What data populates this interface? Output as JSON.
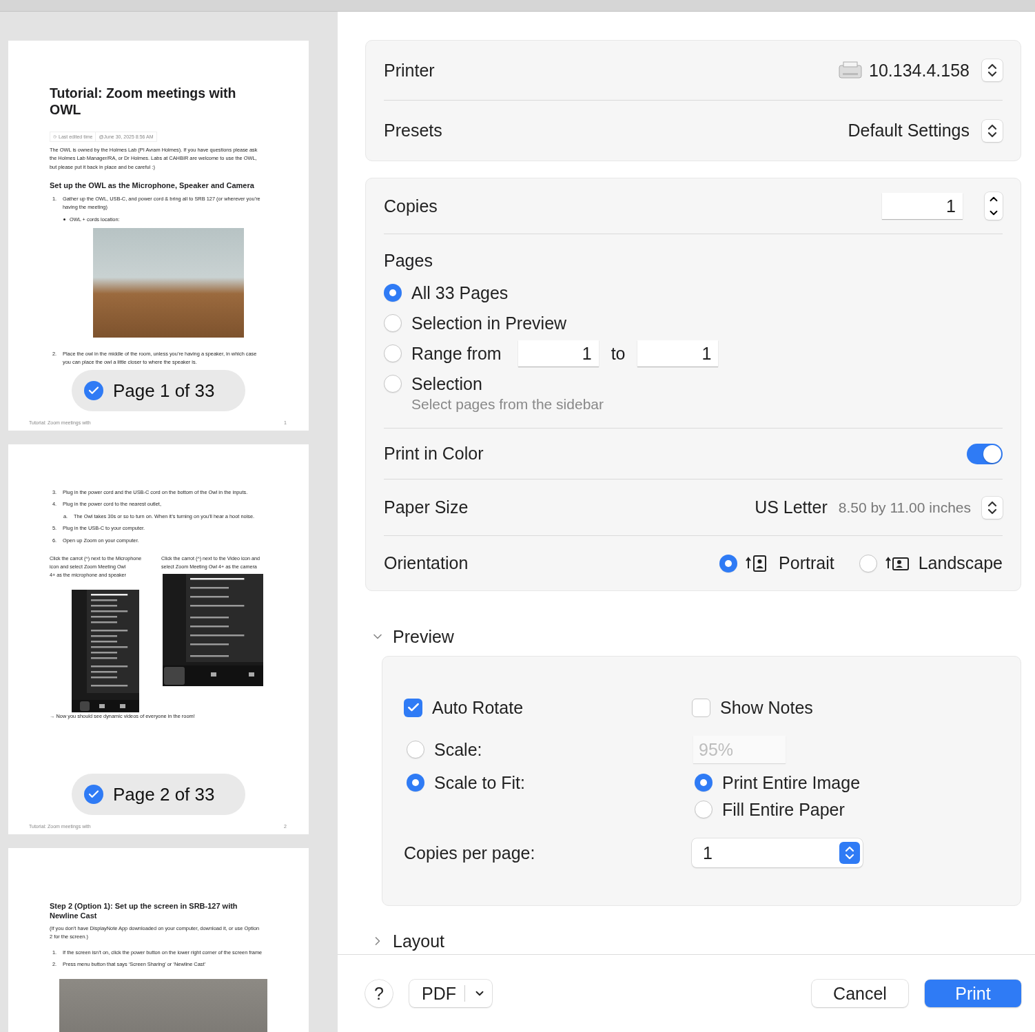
{
  "sidebar": {
    "pages": [
      {
        "badge": {
          "label": "Page 1 of 33",
          "selected": true
        },
        "footer": {
          "title": "Tutorial: Zoom meetings with",
          "number": "1"
        },
        "blocks": [
          {
            "kind": "title",
            "text": "Tutorial: Zoom meetings with OWL"
          },
          {
            "kind": "meta",
            "label": "Last edited time",
            "value": "@June 30, 2025 8:56 AM"
          },
          {
            "kind": "paragraph",
            "text": "The OWL is owned by the Holmes Lab (PI Avram Holmes). If you have questions please ask the Holmes Lab Manager/RA, or Dr Holmes. Labs at CAHBIR are welcome to use the OWL, but please put it back in place and be careful :)"
          },
          {
            "kind": "heading",
            "text": "Set up the OWL as the Microphone, Speaker and Camera"
          },
          {
            "kind": "item",
            "number": "1.",
            "text": "Gather up the OWL, USB-C, and power cord & bring all to SRB 127 (or wherever you’re having the meeting)"
          },
          {
            "kind": "bullet",
            "text": "OWL + cords location:"
          },
          {
            "kind": "photo"
          },
          {
            "kind": "item",
            "number": "2.",
            "text": "Place the owl in the middle of the room, unless you’re having a speaker, in which case you can place the owl a little closer to where the speaker is."
          }
        ]
      },
      {
        "badge": {
          "label": "Page 2 of 33",
          "selected": true
        },
        "footer": {
          "title": "Tutorial: Zoom meetings with",
          "number": "2"
        },
        "blocks": [
          {
            "kind": "item",
            "number": "3.",
            "text": "Plug in the power cord and the USB-C cord on the bottom of the Owl in the inputs."
          },
          {
            "kind": "item",
            "number": "4.",
            "text": "Plug in the power cord to the nearest outlet,"
          },
          {
            "kind": "subitem",
            "number": "a.",
            "text": "The Owl takes 30s or so to turn on. When it’s turning on you'll hear a hoot noise."
          },
          {
            "kind": "item",
            "number": "5.",
            "text": "Plug in the USB-C to your computer."
          },
          {
            "kind": "item",
            "number": "6.",
            "text": "Open up Zoom on your computer."
          },
          {
            "kind": "columns",
            "columns": [
              {
                "texts": [
                  "Click the carrot (^) next to the Microphone icon and select Zoom Meeting Owl",
                  "4+ as the microphone and speaker"
                ],
                "screenshot": {
                  "kind": "audio"
                }
              },
              {
                "texts": [
                  "Click the carrot (^) next to the Video icon and select Zoom Meeting Owl 4+ as the camera"
                ],
                "screenshot": {
                  "kind": "video"
                }
              }
            ]
          },
          {
            "kind": "paragraph",
            "text": "→ Now you should see dynamic videos of everyone in the room!"
          }
        ]
      },
      {
        "blocks": [
          {
            "kind": "heading",
            "text": "Step 2 (Option 1): Set up the screen in SRB-127 with Newline Cast"
          },
          {
            "kind": "paragraph",
            "text": "(If you don't have DisplayNote App downloaded on your computer, download it, or use Option 2 for the screen.)"
          },
          {
            "kind": "item",
            "number": "1.",
            "text": "If the screen isn’t on, click the power button on the lower right corner of the screen frame"
          },
          {
            "kind": "item",
            "number": "2.",
            "text": "Press menu button that says ‘Screen Sharing’ or ‘Newline Cast’"
          },
          {
            "kind": "wide_photo"
          }
        ]
      }
    ]
  },
  "printer": {
    "label": "Printer",
    "value": "10.134.4.158"
  },
  "presets": {
    "label": "Presets",
    "value": "Default Settings"
  },
  "copies": {
    "label": "Copies",
    "value": "1"
  },
  "pages": {
    "label": "Pages",
    "options": [
      {
        "kind": "plain",
        "label": "All 33 Pages",
        "selected": true
      },
      {
        "kind": "plain",
        "label": "Selection in Preview",
        "selected": false
      },
      {
        "kind": "range",
        "label": "Range from",
        "from": "1",
        "to_label": "to",
        "to": "1",
        "selected": false
      },
      {
        "kind": "hint",
        "label": "Selection",
        "hint": "Select pages from the sidebar",
        "selected": false
      }
    ]
  },
  "print_in_color": {
    "label": "Print in Color",
    "on": true
  },
  "paper_size": {
    "label": "Paper Size",
    "value": "US Letter",
    "detail": "8.50 by 11.00 inches"
  },
  "orientation": {
    "label": "Orientation",
    "options": [
      {
        "kind": "portrait",
        "label": "Portrait",
        "selected": true
      },
      {
        "kind": "landscape",
        "label": "Landscape",
        "selected": false
      }
    ]
  },
  "preview": {
    "label": "Preview",
    "expanded": true,
    "auto_rotate": {
      "label": "Auto Rotate",
      "checked": true
    },
    "show_notes": {
      "label": "Show Notes",
      "checked": false
    },
    "scale": {
      "label": "Scale:",
      "selected": false,
      "placeholder": "95%"
    },
    "scale_to_fit": {
      "label": "Scale to Fit:",
      "selected": true,
      "options": [
        {
          "label": "Print Entire Image",
          "selected": true
        },
        {
          "label": "Fill Entire Paper",
          "selected": false
        }
      ]
    },
    "copies_per_page": {
      "label": "Copies per page:",
      "value": "1"
    }
  },
  "layout": {
    "label": "Layout",
    "expanded": false
  },
  "footer": {
    "help": "?",
    "pdf": "PDF",
    "cancel": "Cancel",
    "print": "Print"
  }
}
